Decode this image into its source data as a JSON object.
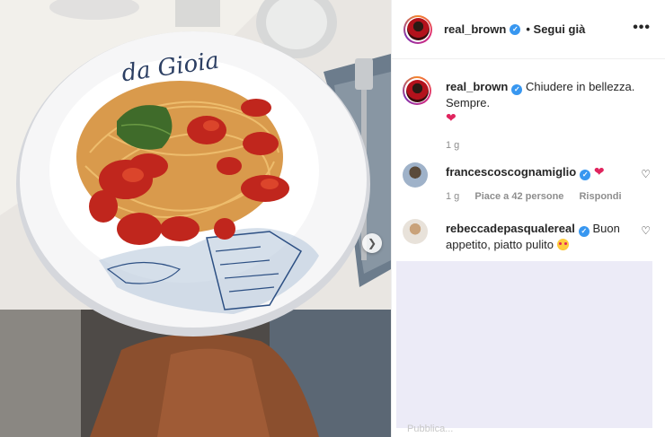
{
  "post": {
    "author": "real_brown",
    "follow_status": "• Segui già",
    "plate_text": "da Gioia"
  },
  "comments": [
    {
      "user": "real_brown",
      "text": "Chiudere in bellezza. Sempre.",
      "emoji": "heart",
      "time": "1 g"
    },
    {
      "user": "francescoscognamiglio",
      "text": "",
      "emoji": "heart",
      "time": "1 g",
      "likes": "Piace a 42 persone",
      "reply": "Rispondi"
    },
    {
      "user": "rebeccadepasqualereal",
      "text": "Buon appetito, piatto pulito",
      "emoji": "heart-eyes-face"
    }
  ],
  "faded_text": "Pubblica..."
}
